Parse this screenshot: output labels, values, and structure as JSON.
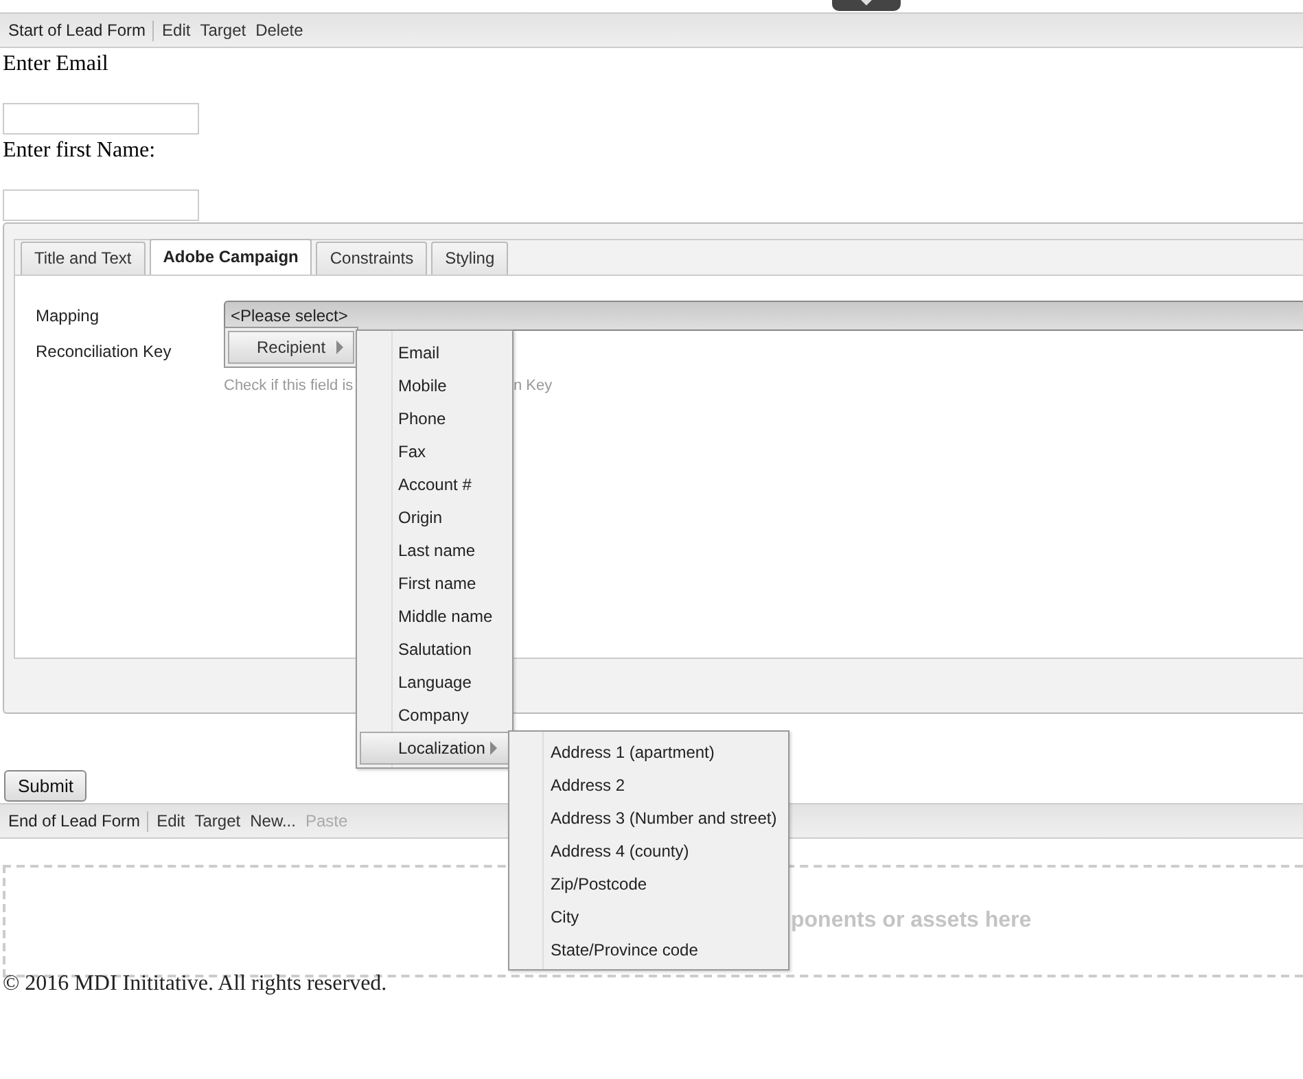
{
  "top_toolbar": {
    "title": "Start of Lead Form",
    "actions": [
      {
        "label": "Edit",
        "disabled": false
      },
      {
        "label": "Target",
        "disabled": false
      },
      {
        "label": "Delete",
        "disabled": false
      }
    ]
  },
  "form_fields": [
    {
      "label": "Enter Email"
    },
    {
      "label": "Enter first Name:"
    }
  ],
  "dialog": {
    "tabs": [
      {
        "label": "Title and Text",
        "selected": false
      },
      {
        "label": "Adobe Campaign",
        "selected": true
      },
      {
        "label": "Constraints",
        "selected": false
      },
      {
        "label": "Styling",
        "selected": false
      }
    ],
    "mapping": {
      "label": "Mapping",
      "value": "<Please select>"
    },
    "reconciliation": {
      "label": "Reconciliation Key",
      "hint_start": "Check if this field is",
      "hint_end": "n Key"
    }
  },
  "menu": {
    "button": "Recipient",
    "items": [
      {
        "label": "Email",
        "has_submenu": false,
        "highlighted": false
      },
      {
        "label": "Mobile",
        "has_submenu": false,
        "highlighted": false
      },
      {
        "label": "Phone",
        "has_submenu": false,
        "highlighted": false
      },
      {
        "label": "Fax",
        "has_submenu": false,
        "highlighted": false
      },
      {
        "label": "Account #",
        "has_submenu": false,
        "highlighted": false
      },
      {
        "label": "Origin",
        "has_submenu": false,
        "highlighted": false
      },
      {
        "label": "Last name",
        "has_submenu": false,
        "highlighted": false
      },
      {
        "label": "First name",
        "has_submenu": false,
        "highlighted": false
      },
      {
        "label": "Middle name",
        "has_submenu": false,
        "highlighted": false
      },
      {
        "label": "Salutation",
        "has_submenu": false,
        "highlighted": false
      },
      {
        "label": "Language",
        "has_submenu": false,
        "highlighted": false
      },
      {
        "label": "Company",
        "has_submenu": false,
        "highlighted": false
      },
      {
        "label": "Localization",
        "has_submenu": true,
        "highlighted": true
      }
    ],
    "submenu": {
      "items": [
        {
          "label": "Address 1 (apartment)"
        },
        {
          "label": "Address 2"
        },
        {
          "label": "Address 3 (Number and street)"
        },
        {
          "label": "Address 4 (county)"
        },
        {
          "label": "Zip/Postcode"
        },
        {
          "label": "City"
        },
        {
          "label": "State/Province code"
        }
      ]
    }
  },
  "submit": "Submit",
  "bottom_toolbar": {
    "title": "End of Lead Form",
    "actions": [
      {
        "label": "Edit",
        "disabled": false
      },
      {
        "label": "Target",
        "disabled": false
      },
      {
        "label": "New...",
        "disabled": false
      },
      {
        "label": "Paste",
        "disabled": true
      }
    ]
  },
  "drop_zone": {
    "text": "ponents or assets here"
  },
  "footer": "© 2016 MDI Inititative. All rights reserved."
}
